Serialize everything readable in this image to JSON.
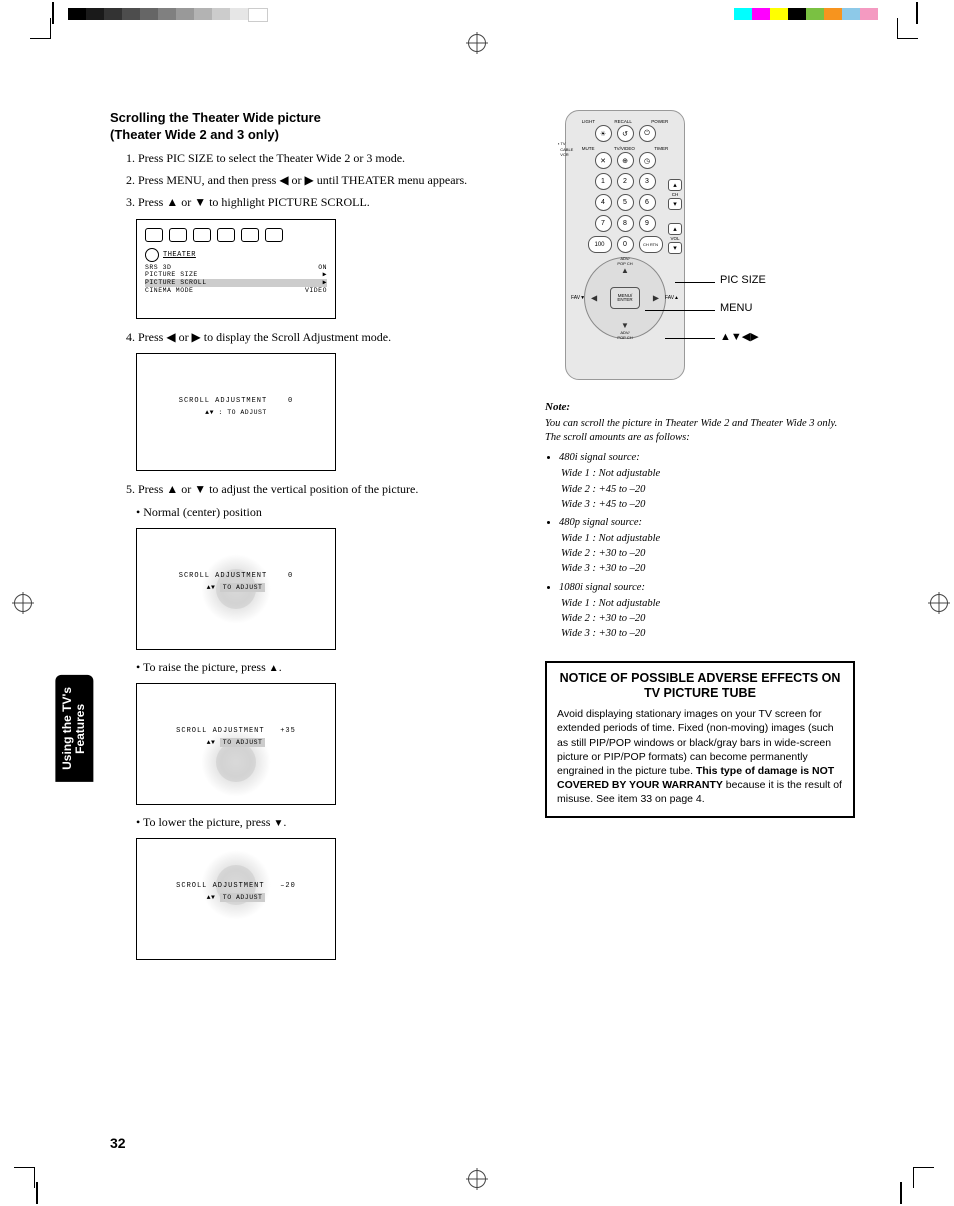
{
  "header": {
    "title_line1": "Scrolling the Theater Wide picture",
    "title_line2": "(Theater Wide 2 and 3 only)"
  },
  "steps": {
    "s1": "Press PIC SIZE to select the Theater Wide 2 or 3 mode.",
    "s2": "Press MENU, and then press ◀ or ▶ until THEATER menu appears.",
    "s3": "Press ▲ or ▼ to highlight PICTURE SCROLL.",
    "s4": "Press ◀ or ▶ to display the Scroll Adjustment mode.",
    "s5": "Press ▲ or ▼ to adjust the vertical position of the picture.",
    "b_normal": "• Normal (center) position",
    "b_raise_pre": "• To raise the picture, press ",
    "b_raise_post": ".",
    "b_lower_pre": "• To lower the picture, press ",
    "b_lower_post": "."
  },
  "osd": {
    "theater_label": "THEATER",
    "srs3d": "SRS  3D",
    "srs3d_val": "ON",
    "picsize": "PICTURE  SIZE",
    "picscroll": "PICTURE  SCROLL",
    "cinema": "CINEMA  MODE",
    "cinema_val": "VIDEO",
    "scroll_adj": "SCROLL  ADJUSTMENT",
    "val0": "0",
    "val35": "+35",
    "valm20": "–20",
    "to_adjust": ": TO  ADJUST",
    "to_adjust_hl": "TO  ADJUST"
  },
  "side_tab": {
    "line1": "Using the TV's",
    "line2": "Features"
  },
  "page_number": "32",
  "remote": {
    "top_labels": [
      "LIGHT",
      "RECALL",
      "POWER"
    ],
    "row2_labels": [
      "MUTE",
      "TV/VIDEO",
      "TIMER"
    ],
    "side_toggle": [
      "TV",
      "CABLE",
      "VCR"
    ],
    "numbers": [
      "1",
      "2",
      "3",
      "4",
      "5",
      "6",
      "7",
      "8",
      "9",
      "100",
      "0"
    ],
    "ch_rtn": "CH RTN",
    "adv_pop": "ADV/\nPOP CH",
    "enter": "MENU/\nENTER",
    "fav_l": "FAV▼",
    "fav_r": "FAV▲",
    "ch": "CH",
    "vol": "VOL",
    "pointer1": "PIC SIZE",
    "pointer2": "MENU",
    "pointer3": "▲▼◀▶"
  },
  "note": {
    "title": "Note:",
    "intro": "You can scroll the picture in Theater Wide 2 and Theater Wide 3 only. The scroll amounts are as follows:",
    "src480i": "480i signal source:",
    "src480p": "480p signal source:",
    "src1080i": "1080i signal source:",
    "w1_na": "Wide 1   :  Not adjustable",
    "w2_45": "Wide 2   :  +45 to –20",
    "w3_45": "Wide 3   :  +45 to –20",
    "w2_30": "Wide 2   :  +30 to –20",
    "w3_30": "Wide 3   :  +30 to –20"
  },
  "notice": {
    "title": "NOTICE OF POSSIBLE ADVERSE EFFECTS ON TV PICTURE TUBE",
    "body_pre": "Avoid displaying stationary images on your TV screen for extended periods of time. Fixed (non-moving) images (such as still PIP/POP windows or black/gray bars in wide-screen picture or PIP/POP formats) can become permanently engrained in the picture tube. ",
    "body_bold": "This type of damage is NOT COVERED BY YOUR WARRANTY",
    "body_post": " because it is the result of misuse. See item 33 on page 4."
  }
}
